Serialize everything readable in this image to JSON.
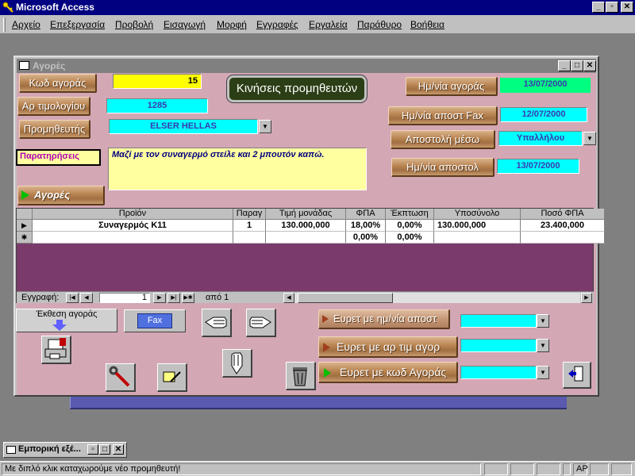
{
  "app": {
    "title": "Microsoft Access"
  },
  "menu": {
    "items": [
      "Αρχείο",
      "Επεξεργασία",
      "Προβολή",
      "Εισαγωγή",
      "Μορφή",
      "Εγγραφές",
      "Εργαλεία",
      "Παράθυρο",
      "Βοήθεια"
    ]
  },
  "form": {
    "title": "Αγορές",
    "purchase_code_label": "Κωδ αγοράς",
    "purchase_code_value": "15",
    "invoice_no_label": "Αρ τιμολογίου",
    "invoice_no_value": "1285",
    "supplier_label": "Προμηθευτής",
    "supplier_value": "ELSER HELLAS",
    "supplier_moves_button": "Κινήσεις προμηθευτών",
    "purchase_date_label": "Ημ/νία αγοράς",
    "purchase_date_value": "13/07/2000",
    "fax_date_label": "Ημ/νία αποστ Fax",
    "fax_date_value": "12/07/2000",
    "send_method_label": "Αποστολή μέσω",
    "send_method_value": "Υπαλλήλου",
    "send_date_label": "Ημ/νία αποστολ",
    "send_date_value": "13/07/2000",
    "notes_label": "Παρατηρήσεις",
    "notes_value": "Μαζί με τον συναγερμό στείλε και 2 μπουτόν καπώ.",
    "purchases_button": "Αγορές"
  },
  "grid": {
    "columns": [
      "Προϊόν",
      "Παραγ",
      "Τιμή μονάδας",
      "ΦΠΑ",
      "Έκπτωση",
      "Υποσύνολο",
      "Ποσό ΦΠΑ"
    ],
    "rows": [
      {
        "product": "Συναγερμός Κ11",
        "qty": "1",
        "unit_price": "130.000,000",
        "vat": "18,00%",
        "discount": "0,00%",
        "subtotal": "130.000,000",
        "vat_amount": "23.400,000"
      }
    ],
    "new_row": {
      "vat": "0,00%",
      "discount": "0,00%"
    },
    "nav_label": "Εγγραφή:",
    "record_number": "1",
    "record_of": "από 1"
  },
  "actions": {
    "report_label": "Έκθεση αγοράς",
    "fax_button": "Fax",
    "find_by_send_date": "Ευρετ με ημ/νία αποστ",
    "find_by_invoice": "Ευρετ με αρ τιμ αγορ",
    "find_by_code": "Ευρετ με κωδ Αγοράς"
  },
  "minimized_window": {
    "title": "Εμπορική εξέ..."
  },
  "status": {
    "message": "Με διπλό κλικ καταχωρούμε νέο προμηθευτή!",
    "indicator": "ΑΡ"
  },
  "colors": {
    "title_active": "#000080",
    "form_bg": "#d4a7b5",
    "cyan_field": "#00ffff",
    "yellow_field": "#ffff00",
    "green_field": "#00ff80",
    "notes_bg": "#ffffa0",
    "dark_button": "#2c3e16"
  }
}
